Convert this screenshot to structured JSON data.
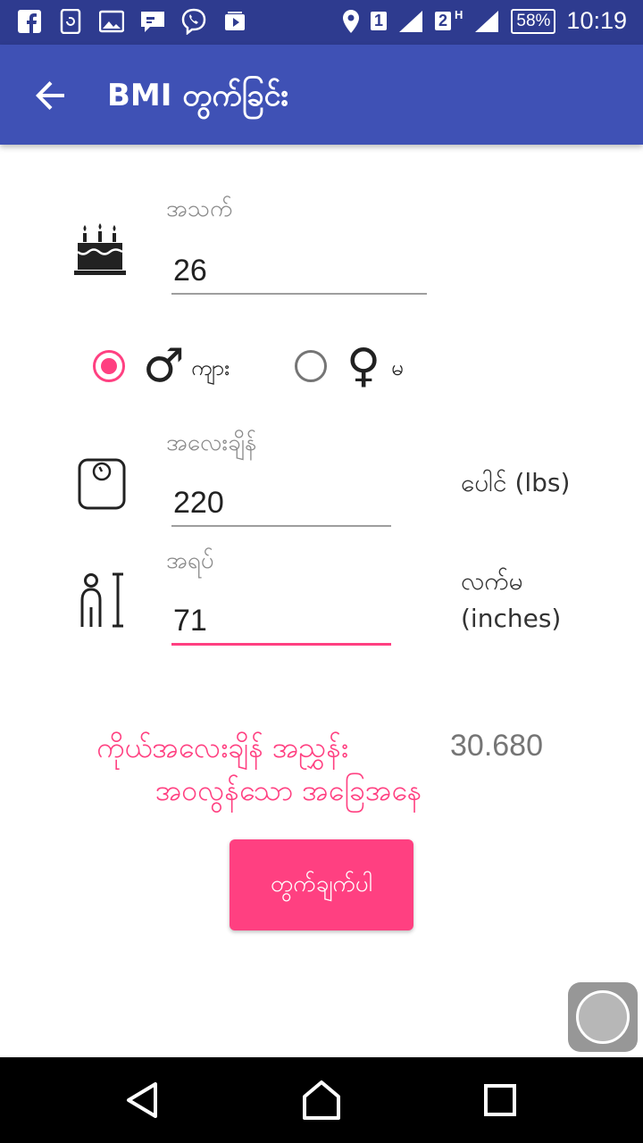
{
  "status_bar": {
    "battery": "58%",
    "time": "10:19",
    "sim1": "1",
    "sim2": "2",
    "network_type": "H"
  },
  "app_bar": {
    "title": "BMI တွက်ခြင်း"
  },
  "age": {
    "label": "အသက်",
    "value": "26"
  },
  "gender": {
    "male_label": "ကျား",
    "female_label": "မ",
    "selected": "male"
  },
  "weight": {
    "label": "အလေးချိန်",
    "value": "220",
    "unit": "ပေါင် (lbs)"
  },
  "height": {
    "label": "အရပ်",
    "value": "71",
    "unit_line1": "လက်မ",
    "unit_line2": "(inches)"
  },
  "result": {
    "label": "ကိုယ်အလေးချိန် အညွှန်း",
    "value": "30.680",
    "status": "အဝလွန်သော အခြေအနေ"
  },
  "calculate_button": "တွက်ချက်ပါ",
  "colors": {
    "status_bar": "#2e3b8f",
    "app_bar": "#3f51b5",
    "accent": "#ff4081"
  }
}
